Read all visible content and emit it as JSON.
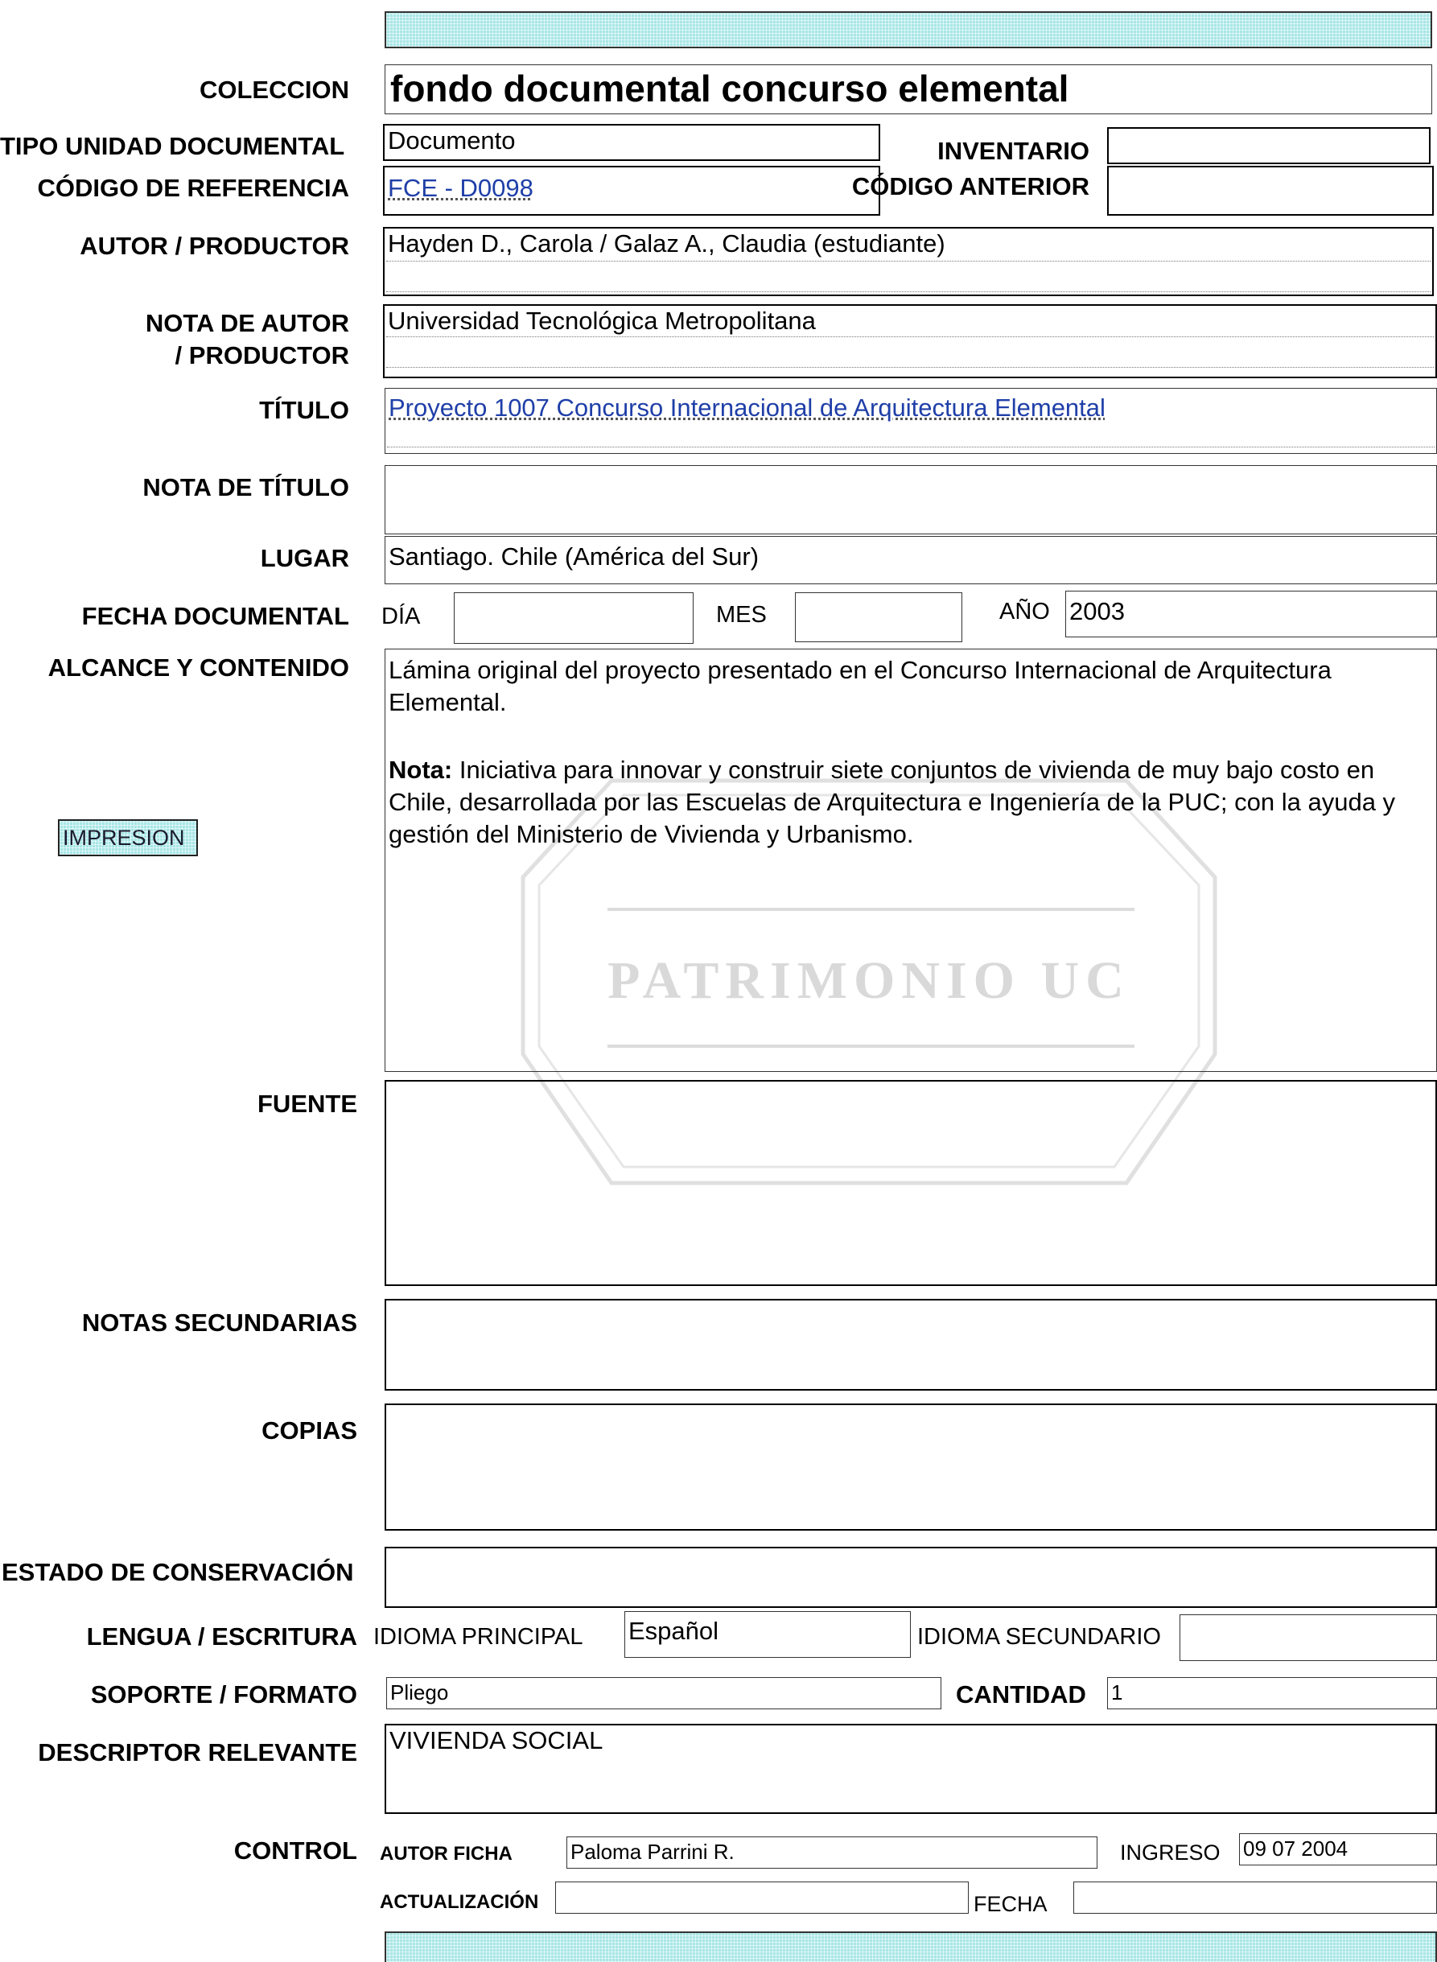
{
  "form": {
    "coleccion_label": "COLECCION",
    "coleccion_value": "fondo documental concurso elemental",
    "tipo_label": "TIPO UNIDAD DOCUMENTAL",
    "tipo_value": "Documento",
    "inventario_label": "INVENTARIO",
    "inventario_value": "",
    "codigo_label": "CÓDIGO DE REFERENCIA",
    "codigo_value": "FCE - D0098",
    "codigo_anterior_label": "CÓDIGO ANTERIOR",
    "codigo_anterior_value": "",
    "autor_label": "AUTOR / PRODUCTOR",
    "autor_value": "Hayden D., Carola / Galaz A., Claudia (estudiante)",
    "nota_autor_label_1": "NOTA DE AUTOR",
    "nota_autor_label_2": "/ PRODUCTOR",
    "nota_autor_value": "Universidad Tecnológica Metropolitana",
    "titulo_label": "TÍTULO",
    "titulo_value": "Proyecto 1007 Concurso Internacional de Arquitectura Elemental",
    "nota_titulo_label": "NOTA DE TÍTULO",
    "nota_titulo_value": "",
    "lugar_label": "LUGAR",
    "lugar_value": "Santiago. Chile (América del Sur)",
    "fecha_label": "FECHA DOCUMENTAL",
    "dia_label": "DÍA",
    "dia_value": "",
    "mes_label": "MES",
    "mes_value": "",
    "anio_label": "AÑO",
    "anio_value": "2003",
    "alcance_label": "ALCANCE Y CONTENIDO",
    "alcance_p1": "Lámina original del proyecto presentado en el Concurso Internacional de Arquitectura Elemental.",
    "alcance_nota_label": "Nota:",
    "alcance_nota_text": " Iniciativa para innovar y construir siete conjuntos de vivienda de muy bajo costo en Chile, desarrollada por las Escuelas de Arquitectura e Ingeniería de la PUC; con la ayuda y gestión del Ministerio de Vivienda y Urbanismo.",
    "impresion_button": "IMPRESION",
    "fuente_label": "FUENTE",
    "fuente_value": "",
    "notas_sec_label": "NOTAS SECUNDARIAS",
    "notas_sec_value": "",
    "copias_label": "COPIAS",
    "copias_value": "",
    "estado_label": "ESTADO DE CONSERVACIÓN",
    "estado_value": "",
    "lengua_label": "LENGUA / ESCRITURA",
    "idioma_principal_label": "IDIOMA PRINCIPAL",
    "idioma_principal_value": "Español",
    "idioma_secundario_label": "IDIOMA SECUNDARIO",
    "idioma_secundario_value": "",
    "soporte_label": "SOPORTE / FORMATO",
    "soporte_value": "Pliego",
    "cantidad_label": "CANTIDAD",
    "cantidad_value": "1",
    "descriptor_label": "DESCRIPTOR RELEVANTE",
    "descriptor_value": "VIVIENDA SOCIAL",
    "control_label": "CONTROL",
    "autor_ficha_label": "AUTOR FICHA",
    "autor_ficha_value": "Paloma Parrini R.",
    "ingreso_label": "INGRESO",
    "ingreso_value": "09 07 2004",
    "actualizacion_label": "ACTUALIZACIÓN",
    "actualizacion_value": "",
    "fecha_ctrl_label": "FECHA",
    "fecha_ctrl_value": ""
  },
  "watermark_text": "PATRIMONIO UC",
  "colors": {
    "accent_cyan": "#a8e6e6",
    "link_blue": "#1f3fa8",
    "watermark_gray": "#d9d9d9"
  }
}
